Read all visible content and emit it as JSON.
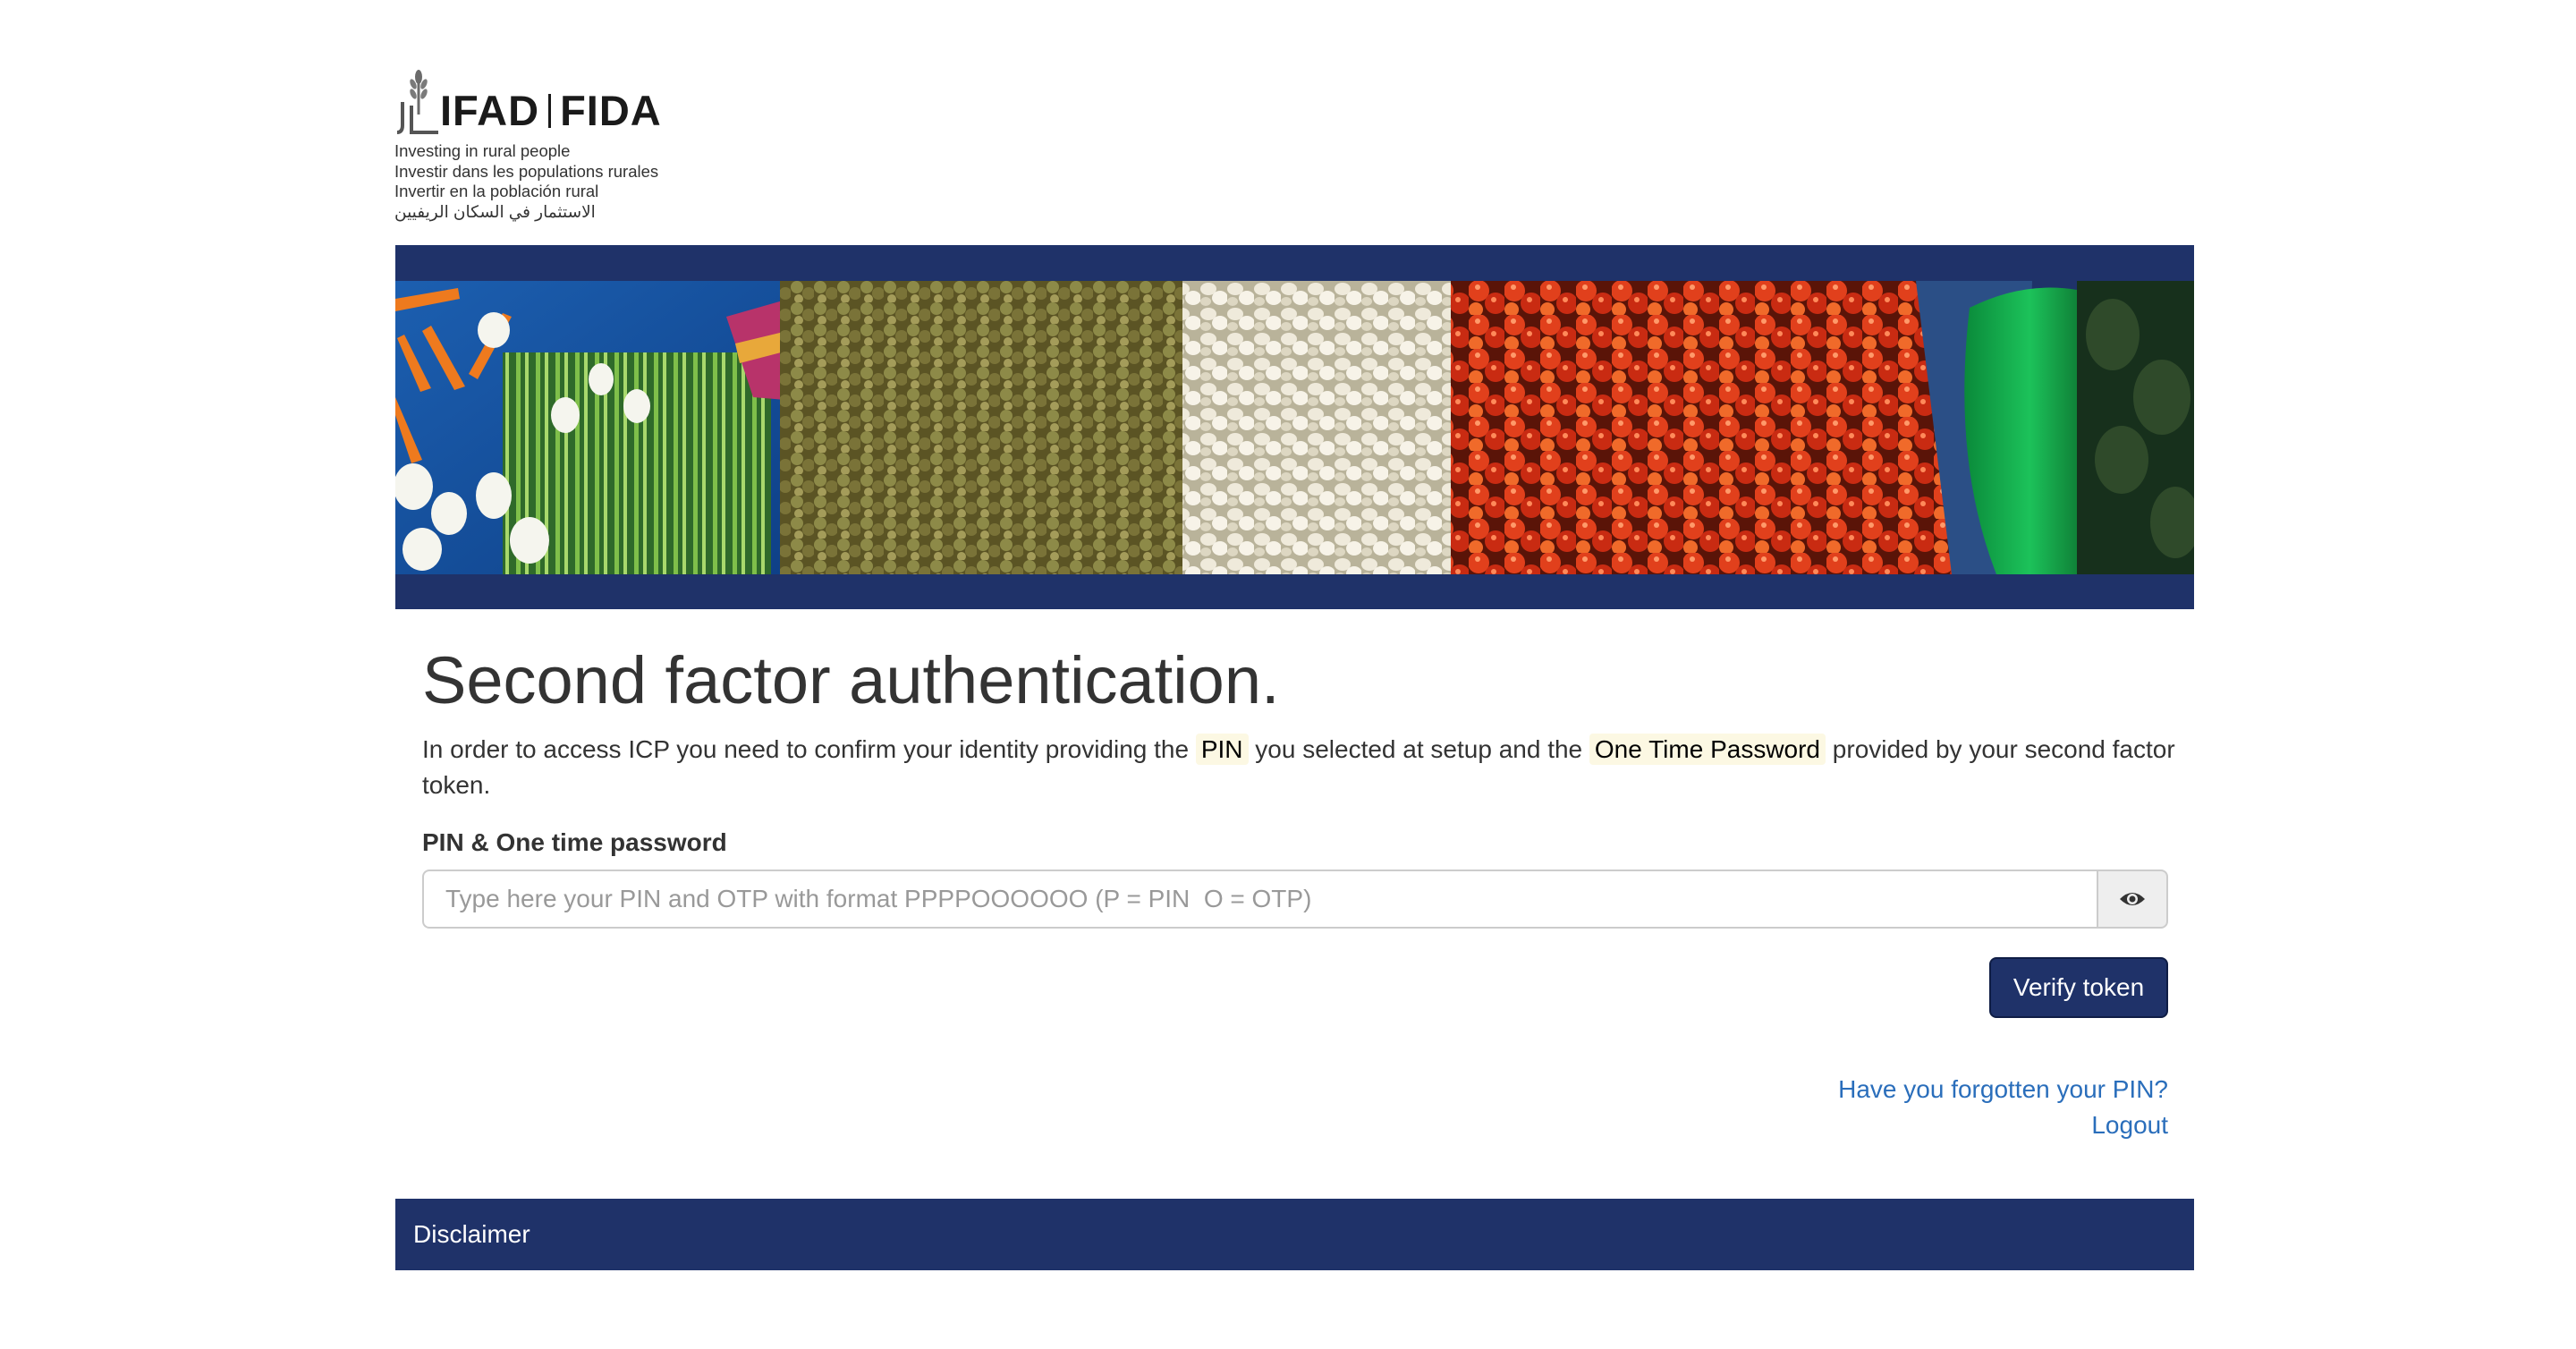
{
  "logo": {
    "org_en": "IFAD",
    "org_fr": "FIDA",
    "taglines": [
      "Investing in rural people",
      "Investir dans les populations rurales",
      "Invertir en la población rural",
      "الاستثمار في السكان الريفيين"
    ]
  },
  "banner": {
    "icon": "vegetable-market-banner-image",
    "bar_color": "#1f3269"
  },
  "main": {
    "title": "Second factor authentication.",
    "intro": {
      "part1": "In order to access ICP you need to confirm your identity providing the ",
      "highlight1": "PIN",
      "part2": " you selected at setup and the ",
      "highlight2": "One Time Password",
      "part3": " provided by your second factor token."
    },
    "field_label": "PIN & One time password",
    "input": {
      "value": "",
      "placeholder": "Type here your PIN and OTP with format PPPPOOOOOO (P = PIN  O = OTP)"
    },
    "toggle_icon": "eye-icon",
    "verify_label": "Verify token",
    "forgot_pin_label": "Have you forgotten your PIN?",
    "logout_label": "Logout"
  },
  "footer": {
    "disclaimer_label": "Disclaimer"
  },
  "colors": {
    "brand_navy": "#1f3269",
    "link_blue": "#2a6ebb",
    "highlight_bg": "#fcf8e3"
  }
}
